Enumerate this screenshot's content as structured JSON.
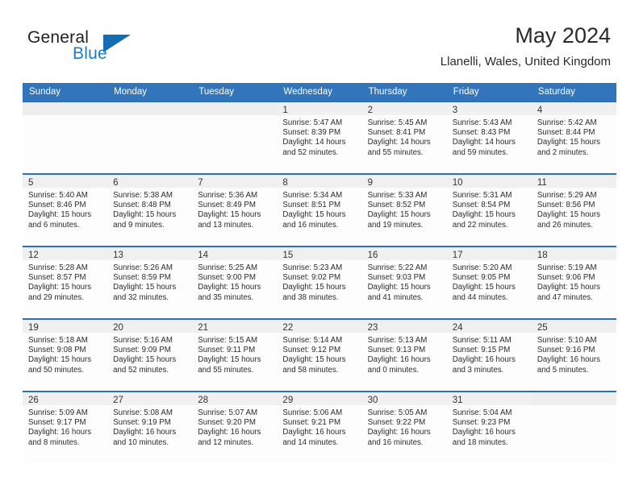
{
  "brand": {
    "name_top": "General",
    "name_bottom": "Blue",
    "triangle_icon": "blue-triangle-logo",
    "color_dark": "#231f20",
    "color_blue": "#1f7cc4"
  },
  "header": {
    "title": "May 2024",
    "location": "Llanelli, Wales, United Kingdom"
  },
  "theme": {
    "header_bar": "#3275bb",
    "cell_top_border": "#2f6fb4",
    "daynum_band": "#f0f0f0"
  },
  "weekdays": [
    "Sunday",
    "Monday",
    "Tuesday",
    "Wednesday",
    "Thursday",
    "Friday",
    "Saturday"
  ],
  "weeks": [
    [
      {
        "day": "",
        "sunrise": "",
        "sunset": "",
        "daylight_1": "",
        "daylight_2": ""
      },
      {
        "day": "",
        "sunrise": "",
        "sunset": "",
        "daylight_1": "",
        "daylight_2": ""
      },
      {
        "day": "",
        "sunrise": "",
        "sunset": "",
        "daylight_1": "",
        "daylight_2": ""
      },
      {
        "day": "1",
        "sunrise": "Sunrise: 5:47 AM",
        "sunset": "Sunset: 8:39 PM",
        "daylight_1": "Daylight: 14 hours",
        "daylight_2": "and 52 minutes."
      },
      {
        "day": "2",
        "sunrise": "Sunrise: 5:45 AM",
        "sunset": "Sunset: 8:41 PM",
        "daylight_1": "Daylight: 14 hours",
        "daylight_2": "and 55 minutes."
      },
      {
        "day": "3",
        "sunrise": "Sunrise: 5:43 AM",
        "sunset": "Sunset: 8:43 PM",
        "daylight_1": "Daylight: 14 hours",
        "daylight_2": "and 59 minutes."
      },
      {
        "day": "4",
        "sunrise": "Sunrise: 5:42 AM",
        "sunset": "Sunset: 8:44 PM",
        "daylight_1": "Daylight: 15 hours",
        "daylight_2": "and 2 minutes."
      }
    ],
    [
      {
        "day": "5",
        "sunrise": "Sunrise: 5:40 AM",
        "sunset": "Sunset: 8:46 PM",
        "daylight_1": "Daylight: 15 hours",
        "daylight_2": "and 6 minutes."
      },
      {
        "day": "6",
        "sunrise": "Sunrise: 5:38 AM",
        "sunset": "Sunset: 8:48 PM",
        "daylight_1": "Daylight: 15 hours",
        "daylight_2": "and 9 minutes."
      },
      {
        "day": "7",
        "sunrise": "Sunrise: 5:36 AM",
        "sunset": "Sunset: 8:49 PM",
        "daylight_1": "Daylight: 15 hours",
        "daylight_2": "and 13 minutes."
      },
      {
        "day": "8",
        "sunrise": "Sunrise: 5:34 AM",
        "sunset": "Sunset: 8:51 PM",
        "daylight_1": "Daylight: 15 hours",
        "daylight_2": "and 16 minutes."
      },
      {
        "day": "9",
        "sunrise": "Sunrise: 5:33 AM",
        "sunset": "Sunset: 8:52 PM",
        "daylight_1": "Daylight: 15 hours",
        "daylight_2": "and 19 minutes."
      },
      {
        "day": "10",
        "sunrise": "Sunrise: 5:31 AM",
        "sunset": "Sunset: 8:54 PM",
        "daylight_1": "Daylight: 15 hours",
        "daylight_2": "and 22 minutes."
      },
      {
        "day": "11",
        "sunrise": "Sunrise: 5:29 AM",
        "sunset": "Sunset: 8:56 PM",
        "daylight_1": "Daylight: 15 hours",
        "daylight_2": "and 26 minutes."
      }
    ],
    [
      {
        "day": "12",
        "sunrise": "Sunrise: 5:28 AM",
        "sunset": "Sunset: 8:57 PM",
        "daylight_1": "Daylight: 15 hours",
        "daylight_2": "and 29 minutes."
      },
      {
        "day": "13",
        "sunrise": "Sunrise: 5:26 AM",
        "sunset": "Sunset: 8:59 PM",
        "daylight_1": "Daylight: 15 hours",
        "daylight_2": "and 32 minutes."
      },
      {
        "day": "14",
        "sunrise": "Sunrise: 5:25 AM",
        "sunset": "Sunset: 9:00 PM",
        "daylight_1": "Daylight: 15 hours",
        "daylight_2": "and 35 minutes."
      },
      {
        "day": "15",
        "sunrise": "Sunrise: 5:23 AM",
        "sunset": "Sunset: 9:02 PM",
        "daylight_1": "Daylight: 15 hours",
        "daylight_2": "and 38 minutes."
      },
      {
        "day": "16",
        "sunrise": "Sunrise: 5:22 AM",
        "sunset": "Sunset: 9:03 PM",
        "daylight_1": "Daylight: 15 hours",
        "daylight_2": "and 41 minutes."
      },
      {
        "day": "17",
        "sunrise": "Sunrise: 5:20 AM",
        "sunset": "Sunset: 9:05 PM",
        "daylight_1": "Daylight: 15 hours",
        "daylight_2": "and 44 minutes."
      },
      {
        "day": "18",
        "sunrise": "Sunrise: 5:19 AM",
        "sunset": "Sunset: 9:06 PM",
        "daylight_1": "Daylight: 15 hours",
        "daylight_2": "and 47 minutes."
      }
    ],
    [
      {
        "day": "19",
        "sunrise": "Sunrise: 5:18 AM",
        "sunset": "Sunset: 9:08 PM",
        "daylight_1": "Daylight: 15 hours",
        "daylight_2": "and 50 minutes."
      },
      {
        "day": "20",
        "sunrise": "Sunrise: 5:16 AM",
        "sunset": "Sunset: 9:09 PM",
        "daylight_1": "Daylight: 15 hours",
        "daylight_2": "and 52 minutes."
      },
      {
        "day": "21",
        "sunrise": "Sunrise: 5:15 AM",
        "sunset": "Sunset: 9:11 PM",
        "daylight_1": "Daylight: 15 hours",
        "daylight_2": "and 55 minutes."
      },
      {
        "day": "22",
        "sunrise": "Sunrise: 5:14 AM",
        "sunset": "Sunset: 9:12 PM",
        "daylight_1": "Daylight: 15 hours",
        "daylight_2": "and 58 minutes."
      },
      {
        "day": "23",
        "sunrise": "Sunrise: 5:13 AM",
        "sunset": "Sunset: 9:13 PM",
        "daylight_1": "Daylight: 16 hours",
        "daylight_2": "and 0 minutes."
      },
      {
        "day": "24",
        "sunrise": "Sunrise: 5:11 AM",
        "sunset": "Sunset: 9:15 PM",
        "daylight_1": "Daylight: 16 hours",
        "daylight_2": "and 3 minutes."
      },
      {
        "day": "25",
        "sunrise": "Sunrise: 5:10 AM",
        "sunset": "Sunset: 9:16 PM",
        "daylight_1": "Daylight: 16 hours",
        "daylight_2": "and 5 minutes."
      }
    ],
    [
      {
        "day": "26",
        "sunrise": "Sunrise: 5:09 AM",
        "sunset": "Sunset: 9:17 PM",
        "daylight_1": "Daylight: 16 hours",
        "daylight_2": "and 8 minutes."
      },
      {
        "day": "27",
        "sunrise": "Sunrise: 5:08 AM",
        "sunset": "Sunset: 9:19 PM",
        "daylight_1": "Daylight: 16 hours",
        "daylight_2": "and 10 minutes."
      },
      {
        "day": "28",
        "sunrise": "Sunrise: 5:07 AM",
        "sunset": "Sunset: 9:20 PM",
        "daylight_1": "Daylight: 16 hours",
        "daylight_2": "and 12 minutes."
      },
      {
        "day": "29",
        "sunrise": "Sunrise: 5:06 AM",
        "sunset": "Sunset: 9:21 PM",
        "daylight_1": "Daylight: 16 hours",
        "daylight_2": "and 14 minutes."
      },
      {
        "day": "30",
        "sunrise": "Sunrise: 5:05 AM",
        "sunset": "Sunset: 9:22 PM",
        "daylight_1": "Daylight: 16 hours",
        "daylight_2": "and 16 minutes."
      },
      {
        "day": "31",
        "sunrise": "Sunrise: 5:04 AM",
        "sunset": "Sunset: 9:23 PM",
        "daylight_1": "Daylight: 16 hours",
        "daylight_2": "and 18 minutes."
      },
      {
        "day": "",
        "sunrise": "",
        "sunset": "",
        "daylight_1": "",
        "daylight_2": ""
      }
    ]
  ]
}
